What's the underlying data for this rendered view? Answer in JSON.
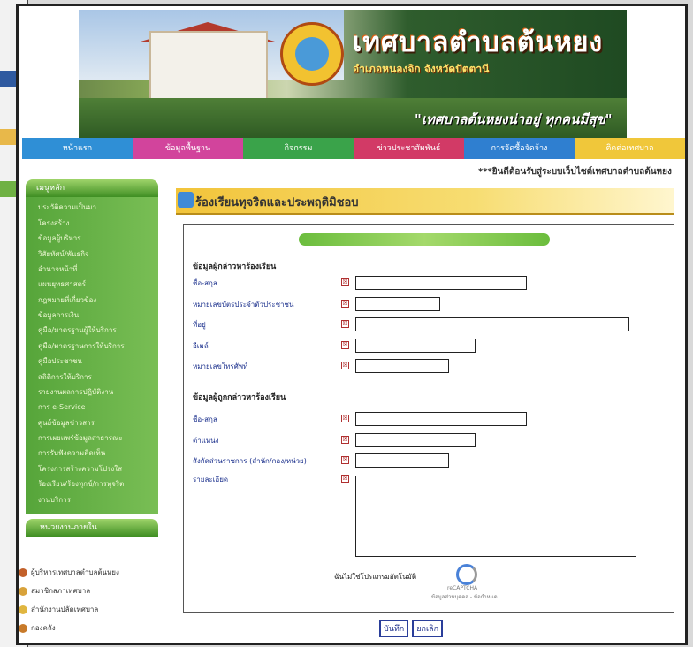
{
  "header": {
    "title": "เทศบาลตำบลต้นหยง",
    "location": "อำเภอหนองจิก จังหวัดปัตตานี",
    "slogan": "\"เทศบาลต้นหยงน่าอยู่ ทุกคนมีสุข\""
  },
  "nav": {
    "tabs": [
      {
        "label": "หน้าแรก",
        "color": "#2f8fd6"
      },
      {
        "label": "ข้อมูลพื้นฐาน",
        "color": "#d2449c"
      },
      {
        "label": "กิจกรรม",
        "color": "#3aa34a"
      },
      {
        "label": "ข่าวประชาสัมพันธ์",
        "color": "#d23a66"
      },
      {
        "label": "การจัดซื้อจัดจ้าง",
        "color": "#2f7fd0"
      },
      {
        "label": "ติดต่อเทศบาล",
        "color": "#f0c73a"
      }
    ]
  },
  "marquee": "***ยินดีต้อนรับสู่ระบบเว็บไซต์เทศบาลตำบลต้นหยง",
  "sidebar": {
    "heading": "เมนูหลัก",
    "items": [
      "ประวัติความเป็นมา",
      "โครงสร้าง",
      "ข้อมูลผู้บริหาร",
      "วิสัยทัศน์/พันธกิจ",
      "อำนาจหน้าที่",
      "แผนยุทธศาสตร์",
      "กฎหมายที่เกี่ยวข้อง",
      "ข้อมูลการเงิน",
      "คู่มือ/มาตรฐานผู้ให้บริการ",
      "คู่มือ/มาตรฐานการให้บริการ",
      "คู่มือประชาชน",
      "สถิติการให้บริการ",
      "รายงานผลการปฏิบัติงาน",
      "การ e-Service",
      "ศูนย์ข้อมูลข่าวสาร",
      "การเผยแพร่ข้อมูลสาธารณะ",
      "การรับฟังความคิดเห็น",
      "โครงการสร้างความโปร่งใส",
      "ร้องเรียน/ร้องทุกข์/การทุจริต",
      "งานบริการ"
    ],
    "heading2": "หน่วยงานภายใน",
    "links": [
      {
        "label": "ผู้บริหารเทศบาลตำบลต้นหยง",
        "color": "#c2602a"
      },
      {
        "label": "สมาชิกสภาเทศบาล",
        "color": "#d8a23a"
      },
      {
        "label": "สำนักงานปลัดเทศบาล",
        "color": "#e0b640"
      },
      {
        "label": "กองคลัง",
        "color": "#c87a2a"
      }
    ]
  },
  "page_title": "ร้องเรียนทุจริตและประพฤติมิชอบ",
  "form": {
    "section1": "ข้อมูลผู้กล่าวหาร้องเรียน",
    "fields1": [
      {
        "label": "ชื่อ-สกุล",
        "width": 194
      },
      {
        "label": "หมายเลขบัตรประจำตัวประชาชน",
        "width": 96
      },
      {
        "label": "ที่อยู่",
        "width": 310
      },
      {
        "label": "อีเมล์",
        "width": 136
      },
      {
        "label": "หมายเลขโทรศัพท์",
        "width": 106
      }
    ],
    "section2": "ข้อมูลผู้ถูกกล่าวหาร้องเรียน",
    "fields2": [
      {
        "label": "ชื่อ-สกุล",
        "width": 194
      },
      {
        "label": "ตำแหน่ง",
        "width": 136
      },
      {
        "label": "สังกัดส่วนราชการ (สำนัก/กอง/หน่วย)",
        "width": 106
      }
    ],
    "detail_label": "รายละเอียด",
    "required_mark": "☒",
    "captcha_label": "ฉันไม่ใช่โปรแกรมอัตโนมัติ",
    "captcha_brand": "reCAPTCHA",
    "captcha_terms": "ข้อมูลส่วนบุคคล - ข้อกำหนด",
    "save_label": "บันทึก",
    "cancel_label": "ยกเลิก"
  }
}
